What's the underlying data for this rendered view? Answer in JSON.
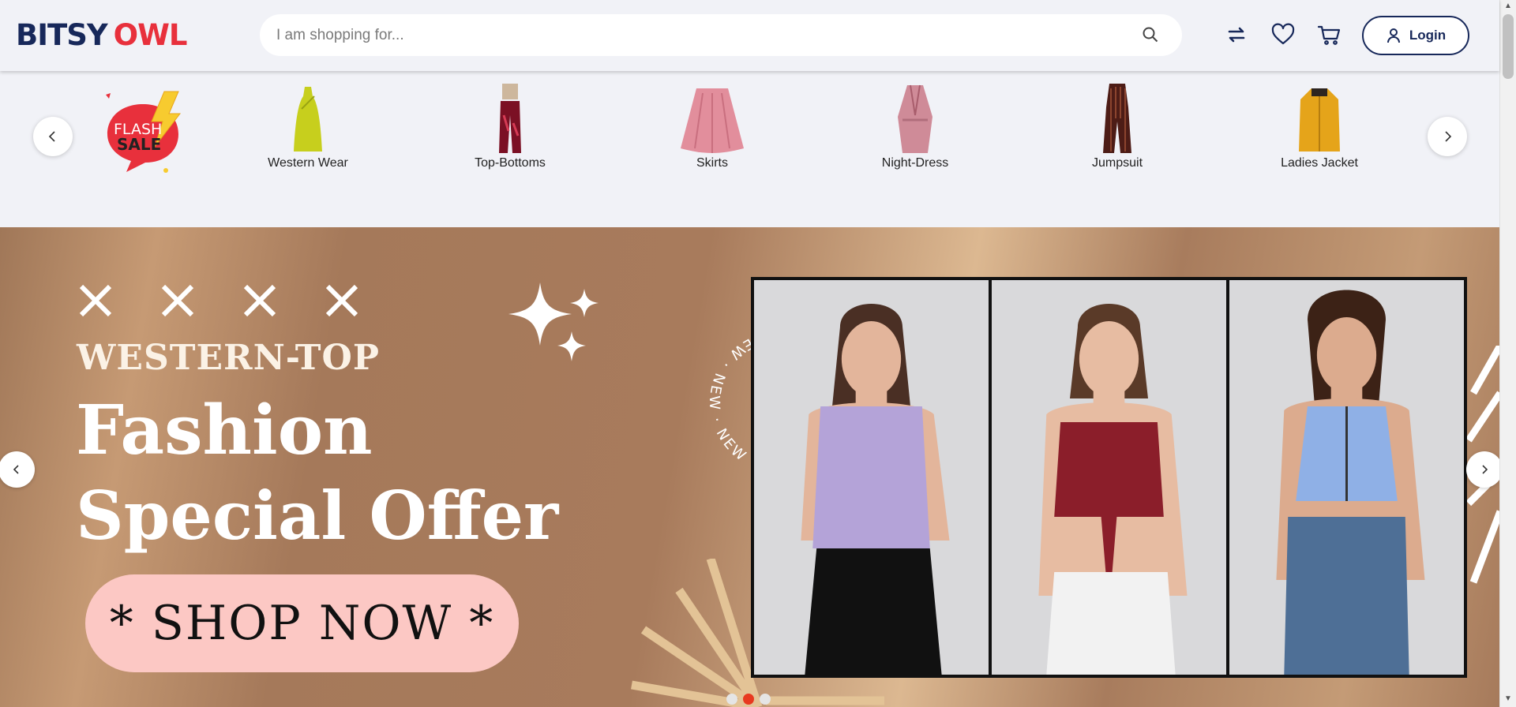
{
  "header": {
    "logo_part1": "BITSY",
    "logo_part2": "OWL",
    "search_placeholder": "I am shopping for...",
    "login_label": "Login",
    "icons": [
      "compare-icon",
      "wishlist-heart-icon",
      "cart-icon",
      "user-icon",
      "search-icon"
    ]
  },
  "categories": {
    "flash_badge": [
      "FLASH",
      "SALE"
    ],
    "items": [
      {
        "label": "Western Wear"
      },
      {
        "label": "Top-Bottoms"
      },
      {
        "label": "Skirts"
      },
      {
        "label": "Night-Dress"
      },
      {
        "label": "Jumpsuit"
      },
      {
        "label": "Ladies Jacket"
      }
    ]
  },
  "banner": {
    "kicker": "WESTERN-TOP",
    "headline1": "Fashion",
    "headline2": "Special Offer",
    "cta": "* SHOP NOW *",
    "ring_text": "NEW · NEW · NEW",
    "slides": 3,
    "active_slide": 2
  },
  "colors": {
    "brand_navy": "#17285a",
    "brand_red": "#e8303c",
    "banner_brown": "#a87b5c",
    "cta_pink": "#fcc8c4",
    "active_dot": "#e8391f"
  }
}
